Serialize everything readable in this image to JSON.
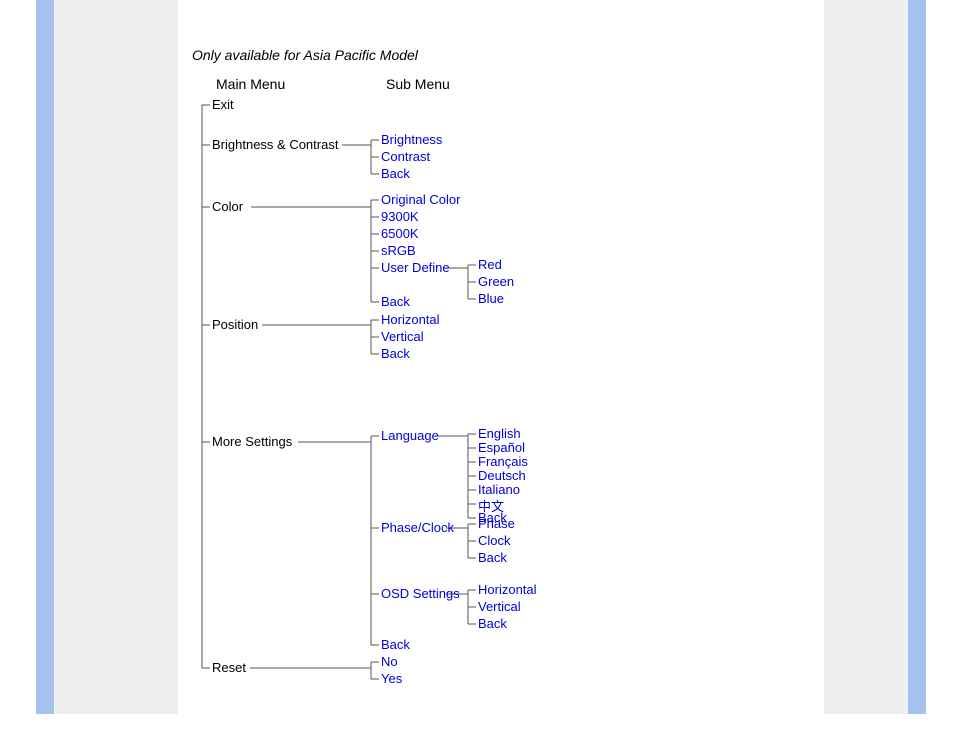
{
  "title": "Only available for Asia Pacific Model",
  "headers": {
    "main": "Main Menu",
    "sub": "Sub Menu"
  },
  "main": {
    "exit": "Exit",
    "brightness": "Brightness & Contrast",
    "color": "Color",
    "position": "Position",
    "more": "More Settings",
    "reset": "Reset"
  },
  "brightness_children": {
    "brightness": "Brightness",
    "contrast": "Contrast",
    "back": "Back"
  },
  "color_children": {
    "original": "Original Color",
    "k9300": "9300K",
    "k6500": "6500K",
    "srgb": "sRGB",
    "userdef": "User Define",
    "back": "Back"
  },
  "userdef_children": {
    "red": "Red",
    "green": "Green",
    "blue": "Blue"
  },
  "position_children": {
    "horizontal": "Horizontal",
    "vertical": "Vertical",
    "back": "Back"
  },
  "more_children": {
    "language": "Language",
    "phaseclock": "Phase/Clock",
    "osd": "OSD Settings",
    "back": "Back"
  },
  "language_children": {
    "english": "English",
    "espanol": "Español",
    "francais": "Français",
    "deutsch": "Deutsch",
    "italiano": "Italiano",
    "chinese": "中文",
    "back": "Back"
  },
  "phaseclock_children": {
    "phase": "Phase",
    "clock": "Clock",
    "back": "Back"
  },
  "osd_children": {
    "horizontal": "Horizontal",
    "vertical": "Vertical",
    "back": "Back"
  },
  "reset_children": {
    "no": "No",
    "yes": "Yes"
  },
  "layout": {
    "xMainBus": 24,
    "xMainLabel": 34,
    "xSubBus": 193,
    "xSubLabel": 203,
    "xThirdBus": 290,
    "xThirdLabel": 300,
    "yTitle": 55,
    "yHeaderMain": 84,
    "xHeaderMain": 38,
    "yHeaderSub": 84,
    "xHeaderSub": 208,
    "yMain": {
      "exit": 105,
      "brightness": 145,
      "color": 207,
      "position": 325,
      "more": 442,
      "reset": 668
    },
    "xMainConnectEnd": {
      "exit": 60,
      "brightness": 164,
      "color": 73,
      "position": 84,
      "more": 120,
      "reset": 72
    },
    "ySub": {
      "brightness": [
        140,
        157,
        174
      ],
      "color": [
        200,
        217,
        234,
        251,
        268,
        302
      ],
      "position": [
        320,
        337,
        354
      ],
      "more": [
        436,
        528,
        594,
        645
      ],
      "reset": [
        662,
        679
      ]
    },
    "yThird": {
      "userdef": [
        265,
        282,
        299
      ],
      "language": [
        434,
        448,
        462,
        476,
        490,
        504,
        518
      ],
      "phaseclock": [
        524,
        541,
        558
      ],
      "osd": [
        590,
        607,
        624
      ]
    },
    "xSubConnectEnd": {
      "userdef": 266,
      "language": 258,
      "phaseclock": 268,
      "osd": 268
    }
  }
}
